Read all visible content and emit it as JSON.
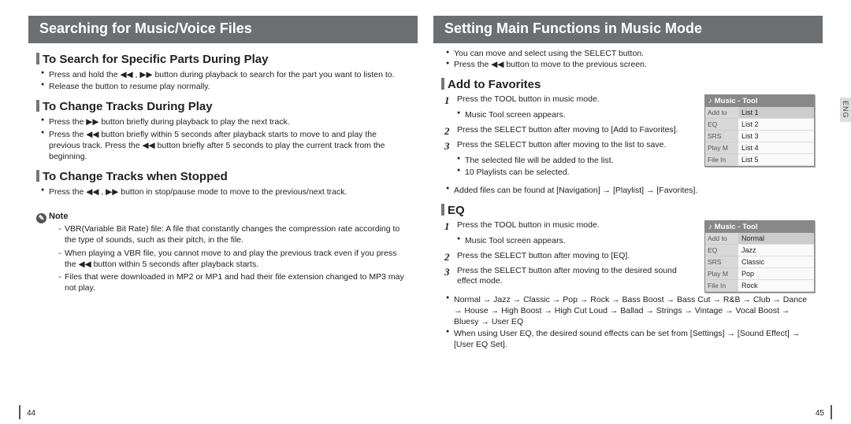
{
  "left": {
    "title": "Searching for Music/Voice Files",
    "sec1": {
      "heading": "To Search for Specific Parts During Play",
      "b1": "Press and hold the ◀◀ , ▶▶ button during playback to search for the part you want to listen to.",
      "b2": "Release the button to resume play normally."
    },
    "sec2": {
      "heading": "To Change Tracks During Play",
      "b1": "Press the ▶▶ button briefly during playback to play the next track.",
      "b2": "Press the ◀◀ button briefly within 5 seconds after playback starts to move to and play the previous track. Press the ◀◀ button briefly after 5 seconds to play the current track from the beginning."
    },
    "sec3": {
      "heading": "To Change Tracks when Stopped",
      "b1": "Press the ◀◀ , ▶▶ button in stop/pause mode to move to the previous/next track."
    },
    "note": {
      "label": "Note",
      "n1": "VBR(Variable Bit Rate) file: A file that constantly changes the compression rate according to the type of sounds, such as their pitch, in the file.",
      "n2": "When playing a VBR file, you cannot move to and play the previous track even if you press the ◀◀ button within 5 seconds after playback starts.",
      "n3": "Files that were downloaded in MP2 or MP1 and had their file extension changed to MP3 may not play."
    },
    "pagenum": "44"
  },
  "right": {
    "title": "Setting Main Functions in Music Mode",
    "intro": {
      "b1": "You can move and select using the SELECT button.",
      "b2": "Press the ◀◀ button to move to the previous screen."
    },
    "fav": {
      "heading": "Add to Favorites",
      "s1": "Press the TOOL button in music mode.",
      "s1b": "Music Tool screen appears.",
      "s2": "Press the SELECT button after moving to [Add to Favorites].",
      "s3": "Press the SELECT button after moving to the list to save.",
      "s3b1": "The selected file will be added to the list.",
      "s3b2": "10 Playlists can be selected.",
      "post": "Added files can be found at [Navigation] → [Playlist] → [Favorites].",
      "widget_title": "Music - Tool",
      "labels": [
        "Add to",
        "EQ",
        "SRS",
        "Play M",
        "File In"
      ],
      "items": [
        "List 1",
        "List 2",
        "List 3",
        "List 4",
        "List 5"
      ]
    },
    "eq": {
      "heading": "EQ",
      "s1": "Press the TOOL button in music mode.",
      "s1b": "Music Tool screen appears.",
      "s2": "Press the SELECT button after moving to [EQ].",
      "s3": "Press the SELECT button after moving to the desired sound effect mode.",
      "flow": "Normal → Jazz → Classic → Pop → Rock → Bass Boost → Bass Cut → R&B → Club → Dance → House → High Boost → High Cut Loud → Ballad → Strings → Vintage → Vocal Boost → Bluesy → User EQ",
      "note": "When using User EQ, the desired sound effects can be set from [Settings] → [Sound Effect] → [User EQ Set].",
      "widget_title": "Music - Tool",
      "labels": [
        "Add to",
        "EQ",
        "SRS",
        "Play M",
        "File In"
      ],
      "items": [
        "Normal",
        "Jazz",
        "Classic",
        "Pop",
        "Rock"
      ]
    },
    "pagenum": "45",
    "eng": "ENG"
  }
}
